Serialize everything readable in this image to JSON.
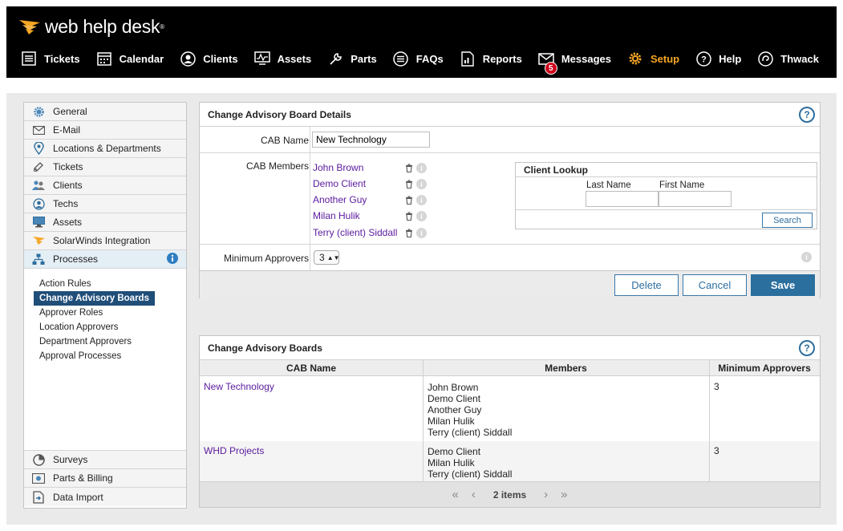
{
  "app": {
    "logo_text": "web help desk"
  },
  "nav": {
    "items": [
      {
        "label": "Tickets",
        "icon": "list-icon"
      },
      {
        "label": "Calendar",
        "icon": "calendar-icon"
      },
      {
        "label": "Clients",
        "icon": "user-circle-icon"
      },
      {
        "label": "Assets",
        "icon": "monitor-icon"
      },
      {
        "label": "Parts",
        "icon": "wrench-icon"
      },
      {
        "label": "FAQs",
        "icon": "faq-icon"
      },
      {
        "label": "Reports",
        "icon": "report-icon"
      },
      {
        "label": "Messages",
        "icon": "envelope-icon",
        "badge": "5"
      },
      {
        "label": "Setup",
        "icon": "gear-icon",
        "active": true
      },
      {
        "label": "Help",
        "icon": "help-icon"
      },
      {
        "label": "Thwack",
        "icon": "thwack-icon"
      }
    ]
  },
  "sidebar": {
    "items": [
      {
        "label": "General",
        "icon": "gear-icon"
      },
      {
        "label": "E-Mail",
        "icon": "envelope-icon"
      },
      {
        "label": "Locations & Departments",
        "icon": "location-pin-icon"
      },
      {
        "label": "Tickets",
        "icon": "ticket-icon"
      },
      {
        "label": "Clients",
        "icon": "users-icon"
      },
      {
        "label": "Techs",
        "icon": "tech-icon"
      },
      {
        "label": "Assets",
        "icon": "monitor-icon"
      },
      {
        "label": "SolarWinds Integration",
        "icon": "solarwinds-icon"
      },
      {
        "label": "Processes",
        "icon": "processes-icon"
      }
    ],
    "sub_items": [
      "Action Rules",
      "Change Advisory Boards",
      "Approver Roles",
      "Location Approvers",
      "Department Approvers",
      "Approval Processes"
    ],
    "bottom_items": [
      {
        "label": "Surveys",
        "icon": "pie-chart-icon"
      },
      {
        "label": "Parts & Billing",
        "icon": "billing-icon"
      },
      {
        "label": "Data Import",
        "icon": "import-icon"
      }
    ]
  },
  "details": {
    "title": "Change Advisory Board Details",
    "cab_name_label": "CAB Name",
    "cab_name_value": "New Technology",
    "members_label": "CAB Members",
    "members": [
      "John Brown",
      "Demo Client",
      "Another Guy",
      "Milan Hulik",
      "Terry (client) Siddall"
    ],
    "lookup": {
      "title": "Client Lookup",
      "last_name_label": "Last Name",
      "first_name_label": "First Name",
      "last_name_value": "",
      "first_name_value": "",
      "search_label": "Search"
    },
    "min_approvers_label": "Minimum Approvers",
    "min_approvers_value": "3",
    "buttons": {
      "delete": "Delete",
      "cancel": "Cancel",
      "save": "Save"
    }
  },
  "boards": {
    "title": "Change Advisory Boards",
    "columns": [
      "CAB Name",
      "Members",
      "Minimum Approvers"
    ],
    "rows": [
      {
        "name": "New Technology",
        "members": [
          "John Brown",
          "Demo Client",
          "Another Guy",
          "Milan Hulik",
          "Terry (client) Siddall"
        ],
        "min": "3"
      },
      {
        "name": "WHD Projects",
        "members": [
          "Demo Client",
          "Milan Hulik",
          "Terry (client) Siddall"
        ],
        "min": "3"
      }
    ],
    "pager_text": "2 items"
  },
  "help_glyph": "?",
  "colors": {
    "accent": "#2a6f9e",
    "active_nav": "#f5a623",
    "link": "#5b1a9e",
    "badge": "#d0021b"
  }
}
